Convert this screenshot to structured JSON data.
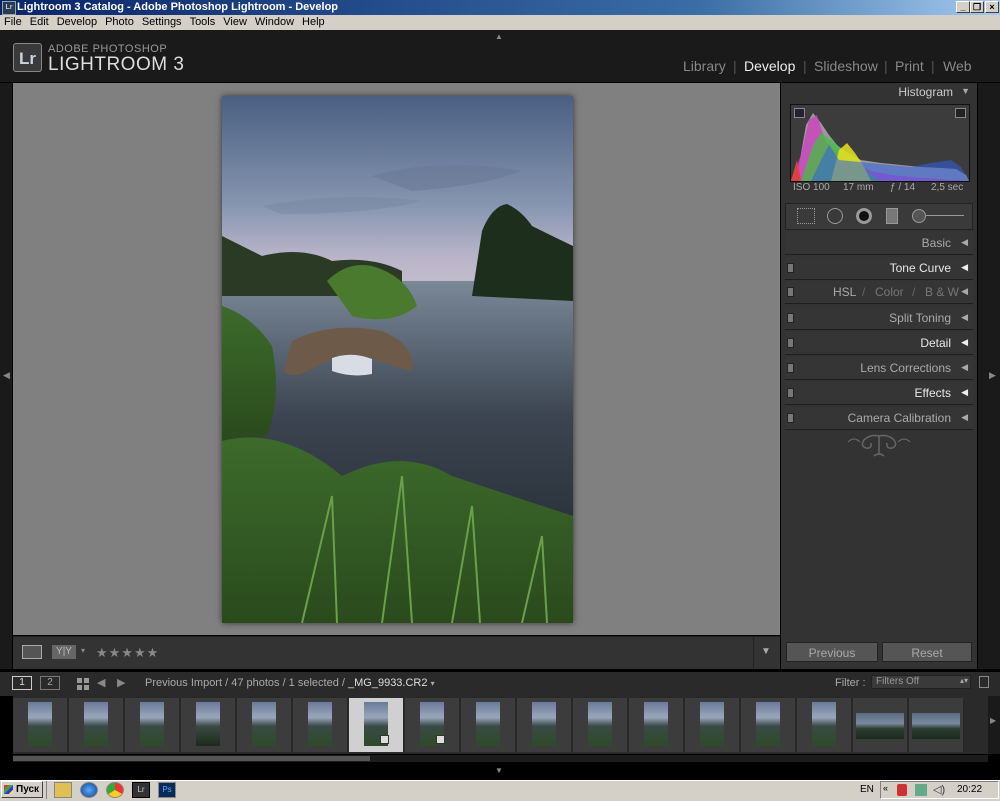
{
  "window": {
    "title": "Lightroom 3 Catalog - Adobe Photoshop Lightroom - Develop",
    "minimize": "_",
    "maximize": "❐",
    "close": "×"
  },
  "menu": [
    "File",
    "Edit",
    "Develop",
    "Photo",
    "Settings",
    "Tools",
    "View",
    "Window",
    "Help"
  ],
  "brand": {
    "logo": "Lr",
    "top": "ADOBE PHOTOSHOP",
    "main": "LIGHTROOM 3"
  },
  "modules": [
    "Library",
    "Develop",
    "Slideshow",
    "Print",
    "Web"
  ],
  "active_module": "Develop",
  "panels": {
    "histogram": "Histogram",
    "meta": {
      "iso": "ISO 100",
      "focal": "17 mm",
      "aperture": "ƒ / 14",
      "shutter": "2,5 sec"
    },
    "basic": "Basic",
    "tone_curve": "Tone Curve",
    "hsl": "HSL",
    "color": "Color",
    "bw": "B & W",
    "split_toning": "Split Toning",
    "detail": "Detail",
    "lens_corrections": "Lens Corrections",
    "effects": "Effects",
    "camera_calibration": "Camera Calibration"
  },
  "buttons": {
    "previous": "Previous",
    "reset": "Reset"
  },
  "toolbar": {
    "yy": "Y|Y",
    "rating": "★★★★★"
  },
  "filmbar": {
    "screen1": "1",
    "screen2": "2",
    "path": "Previous Import / 47 photos / 1 selected / ",
    "filename": "_MG_9933.CR2",
    "filter_label": "Filter :",
    "filter_value": "Filters Off"
  },
  "filmstrip": {
    "count": 17,
    "selected_index": 6
  },
  "taskbar": {
    "start": "Пуск",
    "lang": "EN",
    "time": "20:22"
  }
}
